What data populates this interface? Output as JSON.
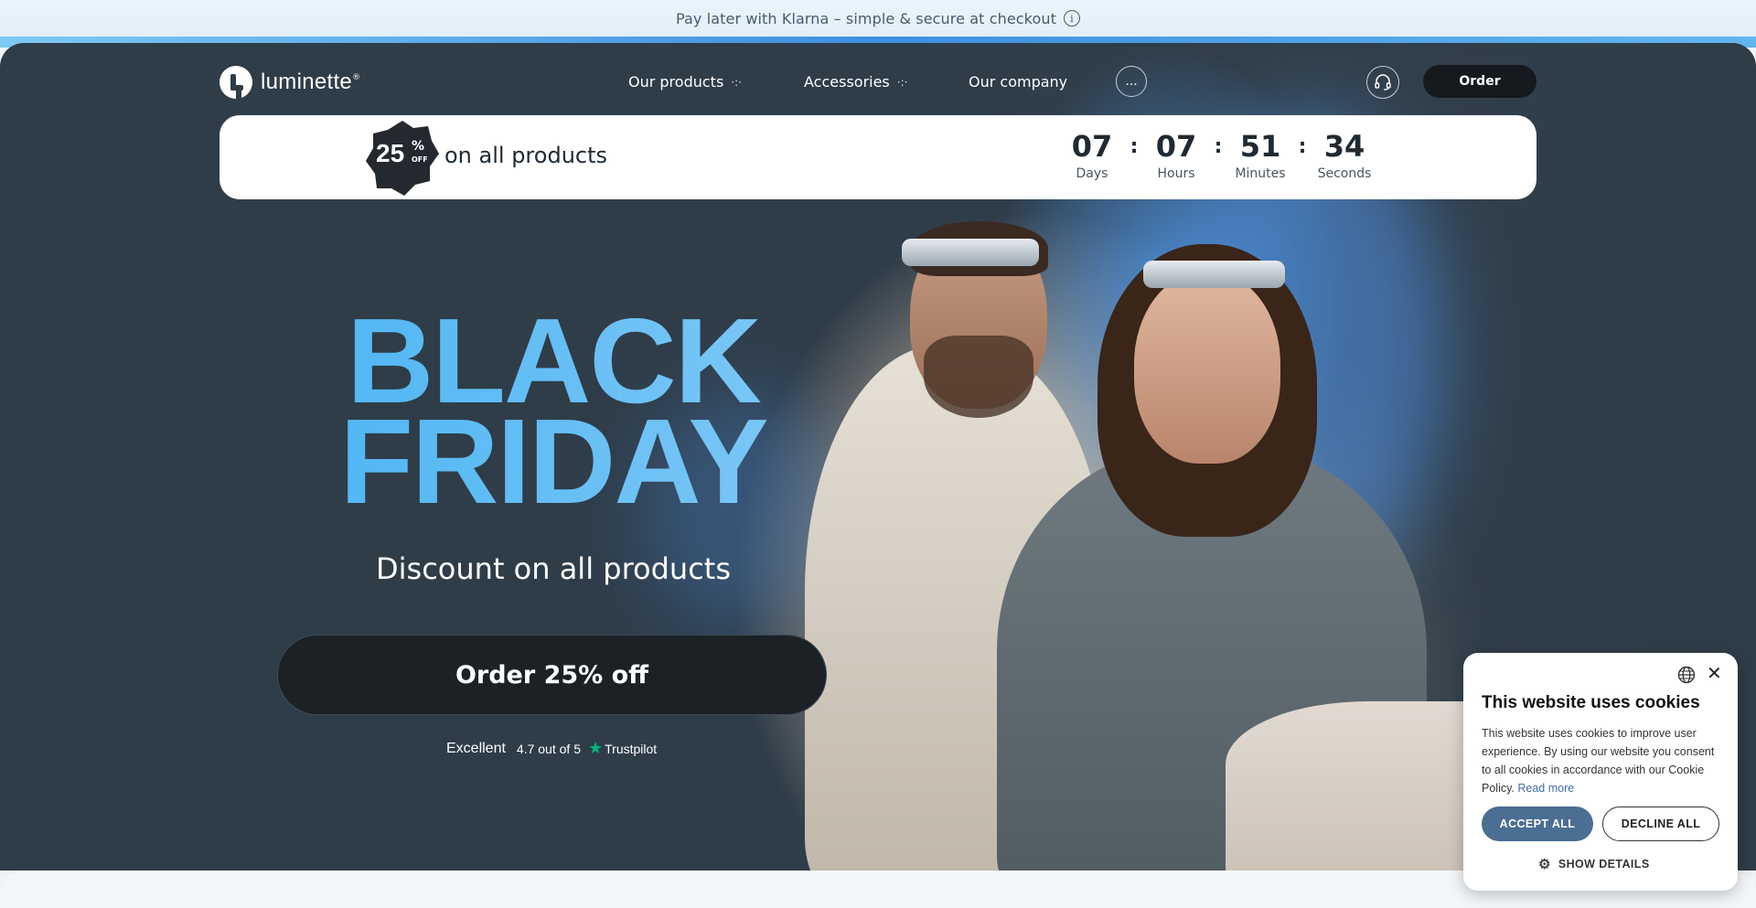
{
  "announcement": {
    "text": "Pay later with Klarna – simple & secure at checkout",
    "info_icon": "info-icon"
  },
  "nav": {
    "logo_text": "luminette",
    "logo_mark": "®",
    "items": [
      {
        "label": "Our products",
        "has_dropdown": true
      },
      {
        "label": "Accessories",
        "has_dropdown": true
      },
      {
        "label": "Our company",
        "has_dropdown": false
      }
    ],
    "dropdown_glyph": "·:·",
    "more_label": "...",
    "support_icon": "headset-icon",
    "order_label": "Order"
  },
  "promo": {
    "badge_number": "25",
    "badge_percent": "%",
    "badge_off": "OFF",
    "text": "on all products",
    "countdown": [
      {
        "value": "07",
        "label": "Days"
      },
      {
        "value": "07",
        "label": "Hours"
      },
      {
        "value": "51",
        "label": "Minutes"
      },
      {
        "value": "34",
        "label": "Seconds"
      }
    ],
    "separator": ":"
  },
  "hero": {
    "headline_line1": "BLACK",
    "headline_line2": "FRIDAY",
    "subheadline": "Discount on all products",
    "cta_label": "Order 25% off",
    "trust_rating_word": "Excellent",
    "trust_score": "4.7 out of 5",
    "trust_brand": "Trustpilot",
    "colors": {
      "headline": "#5bbaf3",
      "trust_star": "#00b67a",
      "background": "#2f3d49"
    }
  },
  "cookie_banner": {
    "title": "This website uses cookies",
    "body": "This website uses cookies to improve user experience. By using our website you consent to all cookies in accordance with our Cookie Policy.",
    "read_more": "Read more",
    "accept_label": "ACCEPT ALL",
    "decline_label": "DECLINE ALL",
    "details_label": "SHOW DETAILS",
    "close_glyph": "✕",
    "colors": {
      "accept": "#4b6e93"
    }
  }
}
